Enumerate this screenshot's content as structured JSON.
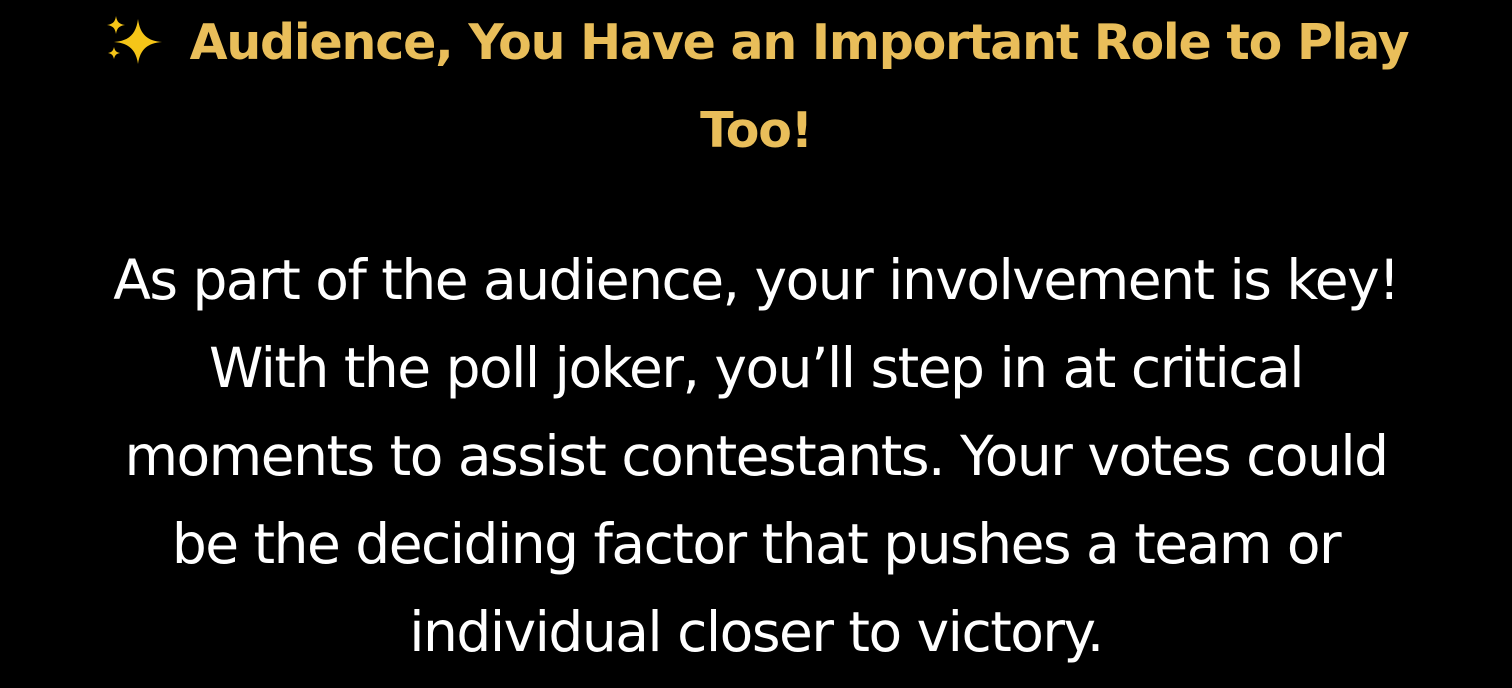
{
  "section": {
    "heading": {
      "icon": "sparkles-icon",
      "line1": "Audience, You Have an Important Role to Play",
      "line2": "Too!",
      "color": "#E9BE5A"
    },
    "body": {
      "lines": [
        "As part of the audience, your involvement is key!",
        "With the poll joker, you’ll step in at critical",
        "moments to assist contestants. Your votes could",
        "be the deciding factor that pushes a team or",
        "individual closer to victory."
      ],
      "color": "#FFFFFF"
    },
    "background": "#000000"
  }
}
